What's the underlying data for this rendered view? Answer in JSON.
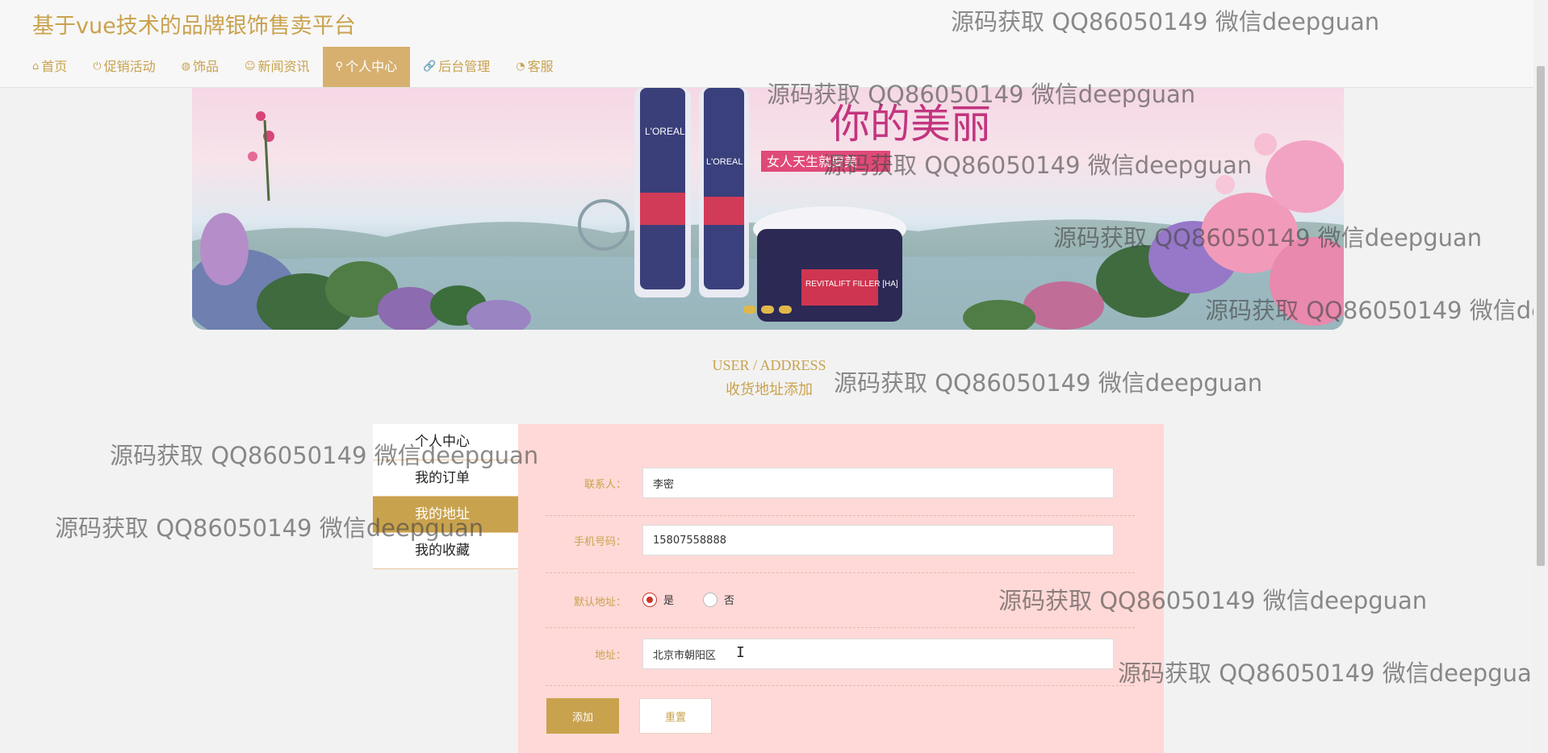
{
  "header": {
    "title": "基于vue技术的品牌银饰售卖平台",
    "nav": [
      {
        "label": "首页",
        "icon": "⌂",
        "icon_name": "home-icon"
      },
      {
        "label": "促销活动",
        "icon": "⏻",
        "icon_name": "power-icon"
      },
      {
        "label": "饰品",
        "icon": "◍",
        "icon_name": "globe-icon"
      },
      {
        "label": "新闻资讯",
        "icon": "☺",
        "icon_name": "smile-icon"
      },
      {
        "label": "个人中心",
        "icon": "⚲",
        "icon_name": "user-icon",
        "active": true
      },
      {
        "label": "后台管理",
        "icon": "🔗",
        "icon_name": "link-icon"
      },
      {
        "label": "客服",
        "icon": "◔",
        "icon_name": "chat-icon"
      }
    ]
  },
  "banner": {
    "product_brand": "L'OREAL",
    "product_name": "REVITALIFT FILLER [HA]",
    "headline": "你的美丽",
    "tagline": "女人天生就要美",
    "carousel_dots": 3
  },
  "section": {
    "title_en": "USER / ADDRESS",
    "title_cn": "收货地址添加"
  },
  "side_menu": [
    {
      "label": "个人中心"
    },
    {
      "label": "我的订单"
    },
    {
      "label": "我的地址",
      "active": true
    },
    {
      "label": "我的收藏"
    }
  ],
  "form": {
    "contact": {
      "label": "联系人：",
      "value": "李密"
    },
    "phone": {
      "label": "手机号码：",
      "value": "15807558888"
    },
    "default_address": {
      "label": "默认地址：",
      "options": [
        "是",
        "否"
      ],
      "selected": "是"
    },
    "address": {
      "label": "地址：",
      "value": "北京市朝阳区"
    },
    "add_button": "添加",
    "reset_button": "重置"
  },
  "watermark": "源码获取 QQ86050149 微信deepguan",
  "colors": {
    "accent": "#c9a24e",
    "active_nav": "#d7b070",
    "panel_bg": "#ffd9d7",
    "radio_checked": "#d0342c"
  }
}
